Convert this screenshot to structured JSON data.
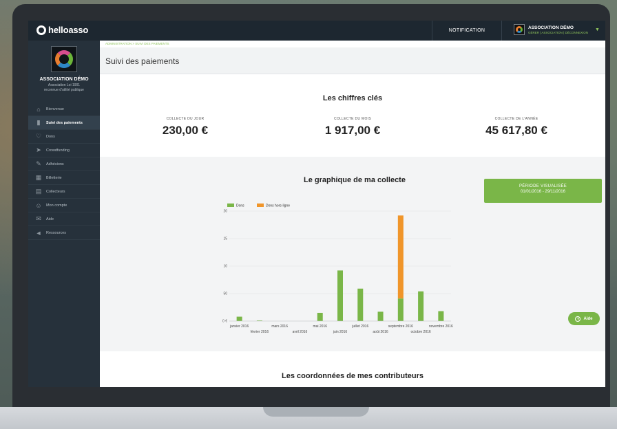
{
  "topbar": {
    "brand": "helloasso",
    "notification_label": "NOTIFICATION",
    "account_name": "ASSOCIATION DÉMO",
    "account_links": "GÉRER | ASSOCIATION | DÉCONNEXION"
  },
  "sidebar": {
    "org_name": "ASSOCIATION DÉMO",
    "org_sub1": "Association Loi 1901",
    "org_sub2": "reconnue d'utilité publique",
    "items": [
      {
        "label": "Bienvenue",
        "icon": "home-icon",
        "active": false
      },
      {
        "label": "Suivi des paiements",
        "icon": "bar-chart-icon",
        "active": true
      },
      {
        "label": "Dons",
        "icon": "heart-icon",
        "active": false
      },
      {
        "label": "Crowdfunding",
        "icon": "paper-plane-icon",
        "active": false
      },
      {
        "label": "Adhésions",
        "icon": "pen-icon",
        "active": false
      },
      {
        "label": "Billetterie",
        "icon": "calendar-icon",
        "active": false
      },
      {
        "label": "Collecteurs",
        "icon": "document-icon",
        "active": false
      },
      {
        "label": "Mon compte",
        "icon": "user-icon",
        "active": false
      },
      {
        "label": "Aide",
        "icon": "chat-icon",
        "active": false
      },
      {
        "label": "Ressources",
        "icon": "megaphone-icon",
        "active": false
      }
    ]
  },
  "main": {
    "breadcrumb": "ADMINISTRATION > SUIVI DES PAIEMENTS",
    "page_title": "Suivi des paiements",
    "kpis_title": "Les chiffres clés",
    "kpis": [
      {
        "label": "COLLECTE DU JOUR",
        "value": "230,00 €"
      },
      {
        "label": "COLLECTE DU MOIS",
        "value": "1 917,00 €"
      },
      {
        "label": "COLLECTE DE L'ANNÉE",
        "value": "45 617,80 €"
      }
    ],
    "graph_title": "Le graphique de ma collecte",
    "periode_label": "PÉRIODE VISUALISÉE",
    "periode_dates": "01/01/2016 - 29/11/2016",
    "aide_label": "Aide",
    "contrib_title": "Les coordonnées de mes contributeurs"
  },
  "colors": {
    "dons": "#7ab648",
    "hors_ligne": "#f0952a",
    "accent": "#7ab648",
    "topbar": "#1d2730",
    "sidebar": "#26313b"
  },
  "chart_data": {
    "type": "bar",
    "stacked": true,
    "categories": [
      "janvier 2016",
      "février 2016",
      "mars 2016",
      "avril 2016",
      "mai 2016",
      "juin 2016",
      "juillet 2016",
      "août 2016",
      "septembre 2016",
      "octobre 2016",
      "novembre 2016"
    ],
    "series": [
      {
        "name": "Dons",
        "color": "#7ab648",
        "values": [
          0.8,
          0.1,
          0,
          0,
          1.5,
          9.2,
          5.9,
          1.7,
          4.1,
          5.4,
          1.8
        ]
      },
      {
        "name": "Dons hors-ligne",
        "color": "#f0952a",
        "values": [
          0,
          0,
          0,
          0,
          0,
          0,
          0,
          0,
          15.1,
          0,
          0
        ]
      }
    ],
    "ytick_labels": [
      "0 €",
      "50",
      "10",
      "15",
      "20"
    ],
    "ylim": [
      0,
      20
    ],
    "legend": "top-left",
    "grid": true
  }
}
